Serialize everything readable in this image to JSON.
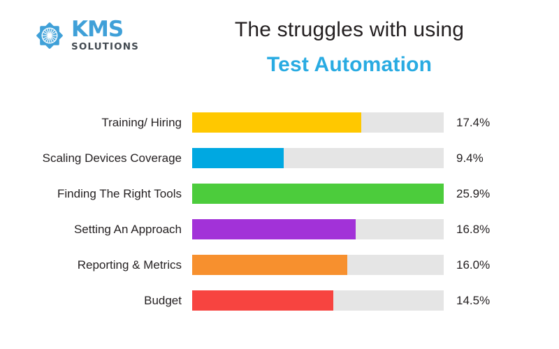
{
  "brand": {
    "logo_word": "KMS",
    "logo_sub": "SOLUTIONS",
    "logo_icon": "kms-sunburst-star-emblem",
    "logo_color": "#3fa0d8",
    "logo_sub_color": "#444b52"
  },
  "header": {
    "title_line1": "The struggles with using",
    "title_line2": "Test Automation",
    "title_line1_color": "#231f20",
    "title_line2_color": "#29abe2"
  },
  "chart_data": {
    "type": "bar",
    "orientation": "horizontal",
    "title": "The struggles with using Test Automation",
    "xlabel": "",
    "ylabel": "",
    "value_suffix": "%",
    "grid": false,
    "legend": false,
    "track_color": "#e5e5e5",
    "scale_max": 25.9,
    "xlim": [
      0,
      25.9
    ],
    "categories": [
      "Training/ Hiring",
      "Scaling Devices Coverage",
      "Finding The Right Tools",
      "Setting An Approach",
      "Reporting & Metrics",
      "Budget"
    ],
    "values": [
      17.4,
      9.4,
      25.9,
      16.8,
      16.0,
      14.5
    ],
    "value_labels": [
      "17.4%",
      "9.4%",
      "25.9%",
      "16.8%",
      "16.0%",
      "14.5%"
    ],
    "colors": [
      "#ffc800",
      "#00a8e1",
      "#4ccc3c",
      "#a232d8",
      "#f7902e",
      "#f74440"
    ],
    "bars": [
      {
        "label": "Training/ Hiring",
        "value": 17.4,
        "value_label": "17.4%",
        "color": "#ffc800",
        "pct_of_track": 67.2
      },
      {
        "label": "Scaling Devices Coverage",
        "value": 9.4,
        "value_label": "9.4%",
        "color": "#00a8e1",
        "pct_of_track": 36.3
      },
      {
        "label": "Finding The Right Tools",
        "value": 25.9,
        "value_label": "25.9%",
        "color": "#4ccc3c",
        "pct_of_track": 100
      },
      {
        "label": "Setting An Approach",
        "value": 16.8,
        "value_label": "16.8%",
        "color": "#a232d8",
        "pct_of_track": 64.9
      },
      {
        "label": "Reporting & Metrics",
        "value": 16.0,
        "value_label": "16.0%",
        "color": "#f7902e",
        "pct_of_track": 61.8
      },
      {
        "label": "Budget",
        "value": 14.5,
        "value_label": "14.5%",
        "color": "#f74440",
        "pct_of_track": 56.0
      }
    ]
  }
}
